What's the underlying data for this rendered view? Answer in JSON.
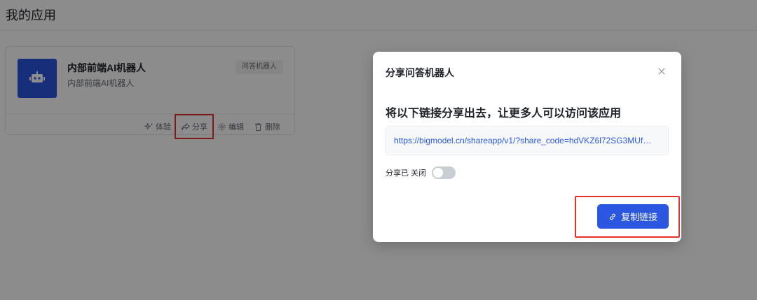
{
  "page": {
    "title": "我的应用"
  },
  "app_card": {
    "name": "内部前端AI机器人",
    "description": "内部前端AI机器人",
    "tag": "问答机器人",
    "avatar_icon": "robot-icon",
    "actions": [
      {
        "label": "体验",
        "icon": "sparkle-icon"
      },
      {
        "label": "分享",
        "icon": "share-icon",
        "highlighted": true
      },
      {
        "label": "编辑",
        "icon": "gear-icon"
      },
      {
        "label": "删除",
        "icon": "trash-icon"
      }
    ]
  },
  "modal": {
    "title": "分享问答机器人",
    "heading": "将以下链接分享出去，让更多人可以访问该应用",
    "link": "https://bigmodel.cn/shareapp/v1/?share_code=hdVKZ6l72SG3MUf…",
    "share_label": "分享已 关闭",
    "share_enabled": false,
    "copy_button": "复制链接",
    "close_icon": "close-icon"
  },
  "colors": {
    "primary": "#2b57e0",
    "highlight": "#e8302a",
    "overlay": "rgba(0,0,0,0.45)"
  }
}
